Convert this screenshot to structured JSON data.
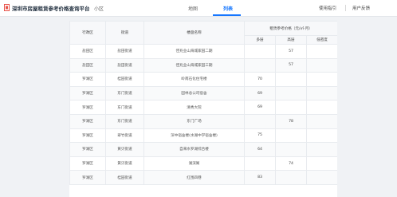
{
  "header": {
    "app_title": "深圳市房屋租赁参考价格查询平台",
    "region_tab": "小区",
    "map_tab": "地图",
    "list_tab": "列表",
    "guide_link": "使用指引",
    "feedback_link": "用户反馈"
  },
  "table": {
    "columns": {
      "district": "行政区",
      "street": "街道",
      "building": "楼盘名称",
      "price_group": "租赁参考价格（元/㎡·月）",
      "multi": "多层",
      "high": "高层",
      "low": "低密度"
    },
    "rows": [
      {
        "district": "盐田区",
        "street": "盐田街道",
        "building": "佳兆业山海城家园二期",
        "multi": "",
        "high": "57",
        "low": ""
      },
      {
        "district": "盐田区",
        "street": "盐田街道",
        "building": "佳兆业山海城家园三期",
        "multi": "",
        "high": "57",
        "low": ""
      },
      {
        "district": "罗湖区",
        "street": "桂园街道",
        "building": "岭南石化住宅楼",
        "multi": "70",
        "high": "",
        "low": ""
      },
      {
        "district": "罗湖区",
        "street": "东门街道",
        "building": "园林总公司宿舍",
        "multi": "69",
        "high": "",
        "low": ""
      },
      {
        "district": "罗湖区",
        "street": "东门街道",
        "building": "清秀大院",
        "multi": "69",
        "high": "",
        "low": ""
      },
      {
        "district": "罗湖区",
        "street": "东门街道",
        "building": "东门广场",
        "multi": "",
        "high": "78",
        "low": ""
      },
      {
        "district": "罗湖区",
        "street": "翠竹街道",
        "building": "深中宿舍楼(水湖中学宿舍楼)",
        "multi": "75",
        "high": "",
        "low": ""
      },
      {
        "district": "罗湖区",
        "street": "黄贝街道",
        "building": "自来水罗湖综合楼",
        "multi": "64",
        "high": "",
        "low": ""
      },
      {
        "district": "罗湖区",
        "street": "黄贝街道",
        "building": "湖滨阁",
        "multi": "",
        "high": "74",
        "low": ""
      },
      {
        "district": "罗湖区",
        "street": "桂园街道",
        "building": "红围四巷",
        "multi": "83",
        "high": "",
        "low": ""
      }
    ]
  },
  "colors": {
    "accent": "#1677ff",
    "logo": "#e8534a"
  },
  "icons": {
    "logo": "house-logo-icon"
  }
}
